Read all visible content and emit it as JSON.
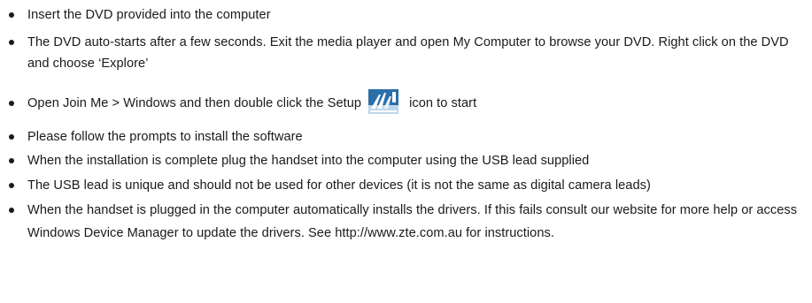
{
  "instructions": [
    {
      "text": "Insert the DVD provided into the computer"
    },
    {
      "text": "The DVD auto-starts after a few seconds. Exit the media player and open My Computer to browse your DVD. Right click on the DVD and choose ‘Explore’"
    },
    {
      "text_before": "Open Join Me > Windows and then double click the Setup",
      "icon": "setup-icon",
      "text_after": "icon to start"
    },
    {
      "text": "Please follow the prompts to install the software"
    },
    {
      "text": "When the installation is complete plug the handset into the computer using the USB lead supplied"
    },
    {
      "text": "The USB lead is unique and should not be used for other devices (it is not the same as digital camera leads)"
    },
    {
      "text": "When the handset is plugged in the computer automatically installs the drivers. If this fails consult our website for more help or access Windows Device Manager to update the drivers. See http://www.zte.com.au for instructions."
    }
  ],
  "colors": {
    "text": "#1a1a1a",
    "icon_blue": "#2a6fa8",
    "icon_light": "#bcd7ea",
    "icon_white": "#ffffff"
  }
}
